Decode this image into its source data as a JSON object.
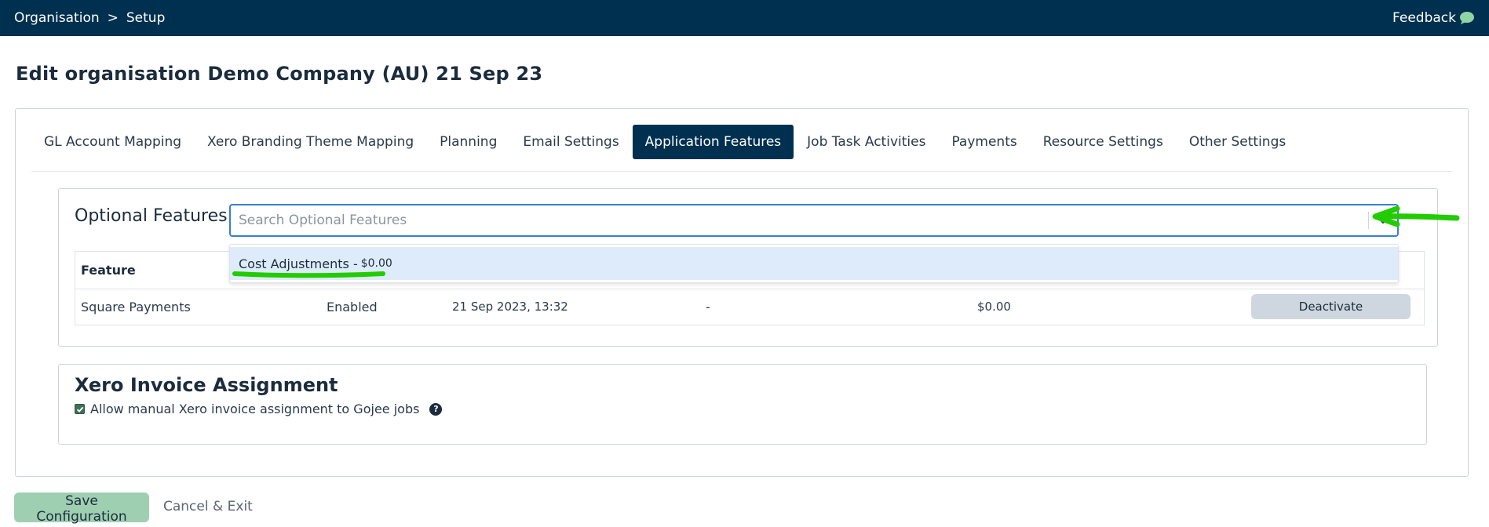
{
  "topbar": {
    "breadcrumb": [
      "Organisation",
      ">",
      "Setup"
    ],
    "feedback_label": "Feedback",
    "feedback_icon": "speech-bubble-icon"
  },
  "page": {
    "title": "Edit organisation Demo Company (AU) 21 Sep 23"
  },
  "tabs": [
    {
      "label": "GL Account Mapping",
      "active": false
    },
    {
      "label": "Xero Branding Theme Mapping",
      "active": false
    },
    {
      "label": "Planning",
      "active": false
    },
    {
      "label": "Email Settings",
      "active": false
    },
    {
      "label": "Application Features",
      "active": true
    },
    {
      "label": "Job Task Activities",
      "active": false
    },
    {
      "label": "Payments",
      "active": false
    },
    {
      "label": "Resource Settings",
      "active": false
    },
    {
      "label": "Other Settings",
      "active": false
    }
  ],
  "optional_features": {
    "title": "Optional Features",
    "search_placeholder": "Search Optional Features",
    "dropdown_option": {
      "name": "Cost Adjustments - ",
      "price": "$0.00"
    },
    "table": {
      "header_feature": "Feature",
      "rows": [
        {
          "feature": "Square Payments",
          "status": "Enabled",
          "date": "21 Sep 2023, 13:32",
          "dash": "-",
          "price": "$0.00",
          "action": "Deactivate"
        }
      ]
    }
  },
  "xero_invoice": {
    "title": "Xero Invoice Assignment",
    "checkbox_label": "Allow manual Xero invoice assignment to Gojee jobs",
    "checked": true,
    "help_icon": "?"
  },
  "actions": {
    "save_label": "Save Configuration",
    "cancel_label": "Cancel & Exit"
  },
  "colors": {
    "topbar": "#00304f",
    "active_tab": "#00304f",
    "save_button": "#9fcfb1",
    "annotation": "#22cc00",
    "search_border": "#3a7fd0"
  }
}
